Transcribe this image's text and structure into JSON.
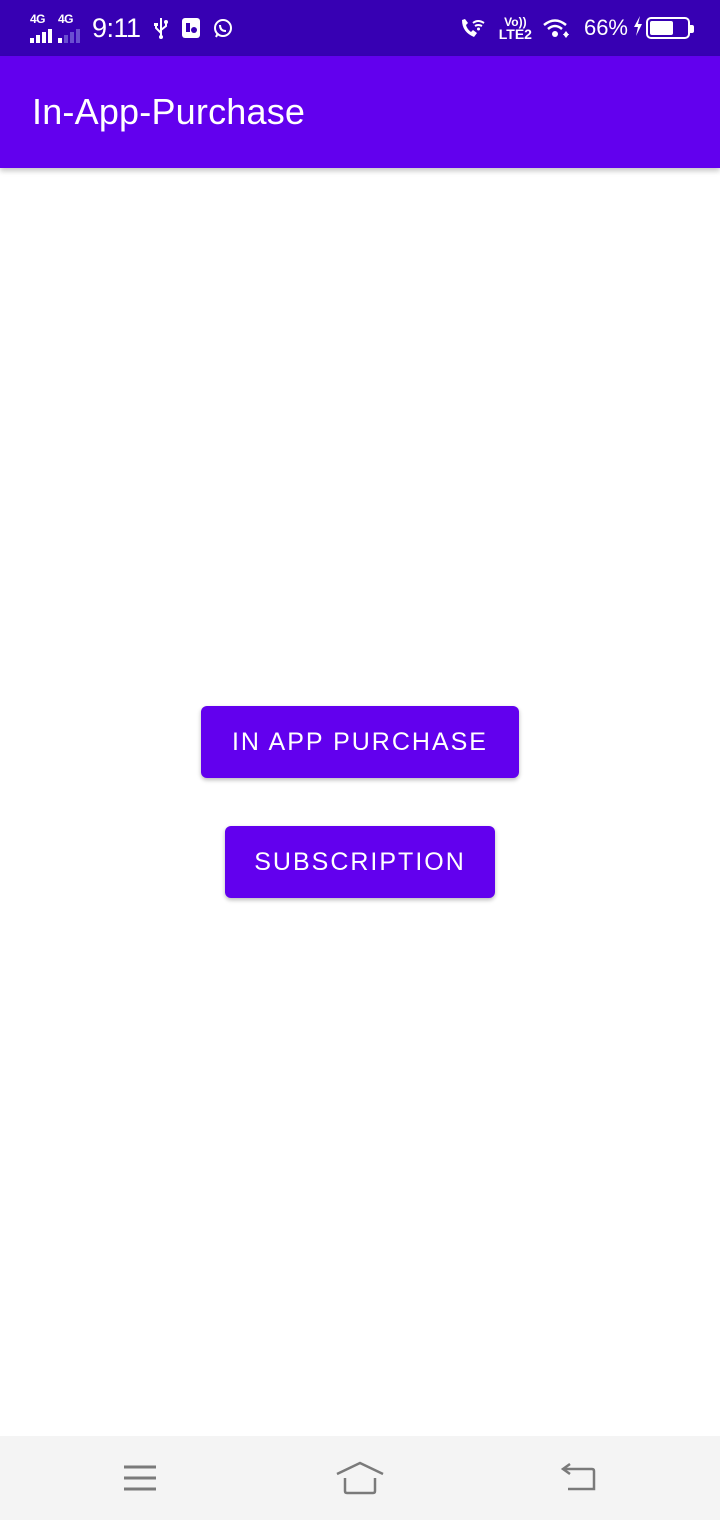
{
  "status_bar": {
    "sim1_network": "4G",
    "sim2_network": "4G",
    "time": "9:11",
    "volte_top": "Vo))",
    "volte_bottom": "LTE2",
    "battery_percent": "66%",
    "battery_level": 0.66,
    "icons": [
      "signal-icon",
      "signal-icon",
      "usb-icon",
      "sim-toolkit-icon",
      "whatsapp-icon",
      "wifi-call-icon",
      "wifi-icon",
      "charging-icon",
      "battery-icon"
    ]
  },
  "app_bar": {
    "title": "In-App-Purchase"
  },
  "main": {
    "in_app_purchase_label": "IN APP PURCHASE",
    "subscription_label": "SUBSCRIPTION"
  },
  "nav_bar": {
    "icons": [
      "menu-icon",
      "home-icon",
      "back-icon"
    ]
  },
  "colors": {
    "status_bar": "#3700b3",
    "primary": "#6200ee",
    "on_primary": "#ffffff",
    "background": "#ffffff",
    "nav_bar": "#f4f4f4",
    "nav_icon": "#7a7a7a"
  }
}
